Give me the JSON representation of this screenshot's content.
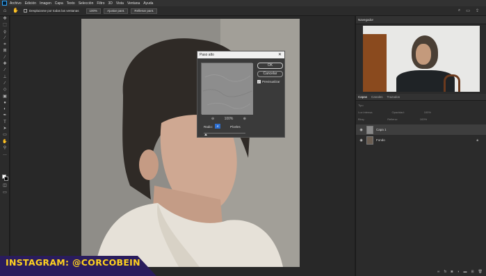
{
  "menubar": {
    "items": [
      "Archivo",
      "Edición",
      "Imagen",
      "Capa",
      "Texto",
      "Selección",
      "Filtro",
      "3D",
      "Vista",
      "Ventana",
      "Ayuda"
    ]
  },
  "options_bar": {
    "scroll_all_label": "Desplazarse por todas las ventanas",
    "zoom_button": "100%",
    "fit_screen_button": "Ajustar pant.",
    "fill_screen_button": "Rellenar pant."
  },
  "dialog": {
    "title": "Paso alto",
    "zoom_value": "100%",
    "radius_label": "Radio:",
    "radius_value": "4",
    "unit_label": "Píxeles",
    "ok_label": "OK",
    "cancel_label": "Cancelar",
    "preview_label": "Previsualizar"
  },
  "navigator": {
    "title": "Navegador"
  },
  "layers_panel": {
    "tabs": [
      "Capas",
      "Canales",
      "Trazados"
    ],
    "filter_placeholder": "Tipo",
    "blend_mode": "Luz intensa",
    "opacity_label": "Opacidad:",
    "opacity_value": "100%",
    "lock_label": "Bloq.:",
    "fill_label": "Relleno:",
    "fill_value": "100%",
    "layers": [
      {
        "name": "Capa 1"
      },
      {
        "name": "Fondo"
      }
    ]
  },
  "banner": {
    "text": "INSTAGRAM: @CORCOBEIN"
  },
  "colors": {
    "accent": "#31a8ff",
    "banner_bg": "#2a1c5c",
    "banner_text": "#ffd21f"
  }
}
